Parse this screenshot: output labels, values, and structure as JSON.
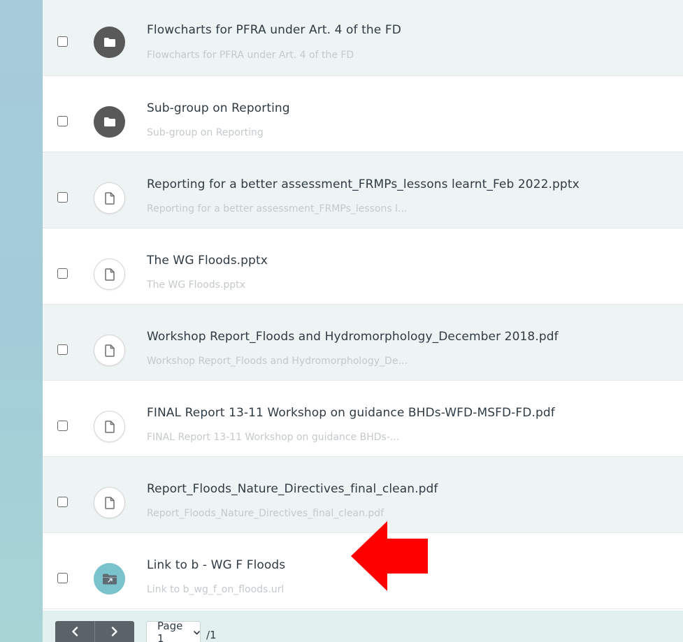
{
  "rows": [
    {
      "title": "Flowcharts for PFRA under Art. 4 of the FD",
      "subtitle": "Flowcharts for PFRA under Art. 4 of the FD",
      "icon": "folder-icon"
    },
    {
      "title": "Sub-group on Reporting",
      "subtitle": "Sub-group on Reporting",
      "icon": "folder-icon"
    },
    {
      "title": "Reporting for a better assessment_FRMPs_lessons learnt_Feb 2022.pptx",
      "subtitle": "Reporting for a better assessment_FRMPs_lessons l...",
      "icon": "file-icon"
    },
    {
      "title": "The WG Floods.pptx",
      "subtitle": "The WG Floods.pptx",
      "icon": "file-icon"
    },
    {
      "title": "Workshop Report_Floods and Hydromorphology_December 2018.pdf",
      "subtitle": "Workshop Report_Floods and Hydromorphology_De...",
      "icon": "file-icon"
    },
    {
      "title": "FINAL Report 13-11 Workshop on guidance BHDs-WFD-MSFD-FD.pdf",
      "subtitle": "FINAL Report 13-11 Workshop on guidance BHDs-...",
      "icon": "file-icon"
    },
    {
      "title": "Report_Floods_Nature_Directives_final_clean.pdf",
      "subtitle": "Report_Floods_Nature_Directives_final_clean.pdf",
      "icon": "file-icon"
    },
    {
      "title": "Link to b - WG F Floods",
      "subtitle": "Link to b_wg_f_on_floods.url",
      "icon": "link-folder-icon"
    }
  ],
  "pager": {
    "prev_icon": "chevron-left-icon",
    "next_icon": "chevron-right-icon",
    "page_label": "Page 1",
    "total": "/1"
  },
  "colors": {
    "annotation_arrow": "#ff0000",
    "folder_icon_bg": "#595959",
    "link_icon_bg": "#7bc3cc",
    "left_strip": "#a6cbdb"
  }
}
